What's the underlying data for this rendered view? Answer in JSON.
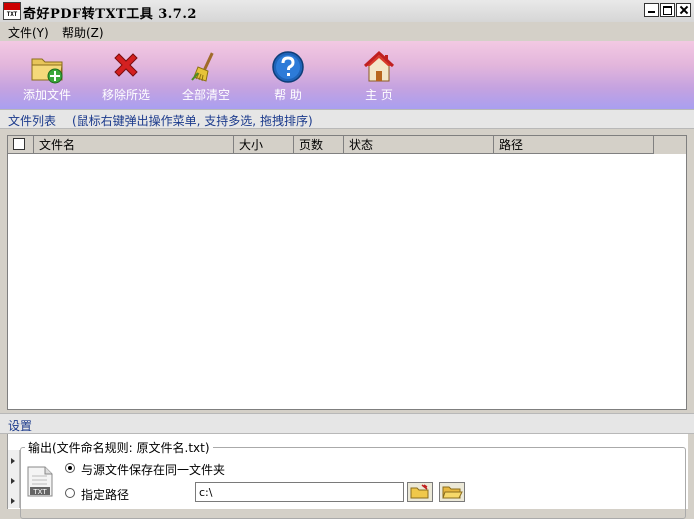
{
  "window": {
    "title": "奇好PDF转TXT工具 3.7.2",
    "icon_text": "TXT"
  },
  "menu": [
    {
      "label": "文件(Y)"
    },
    {
      "label": "帮助(Z)"
    }
  ],
  "toolbar": [
    {
      "label": "添加文件",
      "icon": "add-file-icon"
    },
    {
      "label": "移除所选",
      "icon": "remove-icon"
    },
    {
      "label": "全部清空",
      "icon": "broom-icon"
    },
    {
      "label": "帮 助",
      "icon": "help-icon"
    },
    {
      "label": "主 页",
      "icon": "home-icon"
    }
  ],
  "file_list": {
    "caption": "文件列表",
    "hint": "(鼠标右键弹出操作菜单, 支持多选, 拖拽排序)",
    "columns": [
      "文件名",
      "大小",
      "页数",
      "状态",
      "路径"
    ],
    "rows": []
  },
  "settings": {
    "caption": "设置",
    "output_legend": "输出(文件命名规则: 原文件名.txt)",
    "icon_text": "TXT",
    "option_same_folder": "与源文件保存在同一文件夹",
    "option_custom_path": "指定路径",
    "path_value": "c:\\",
    "selected_option": "same_folder"
  },
  "colors": {
    "toolbar_top": "#f3c9e3",
    "toolbar_bottom": "#a99ff0",
    "caption_text": "#1b3a8c"
  }
}
